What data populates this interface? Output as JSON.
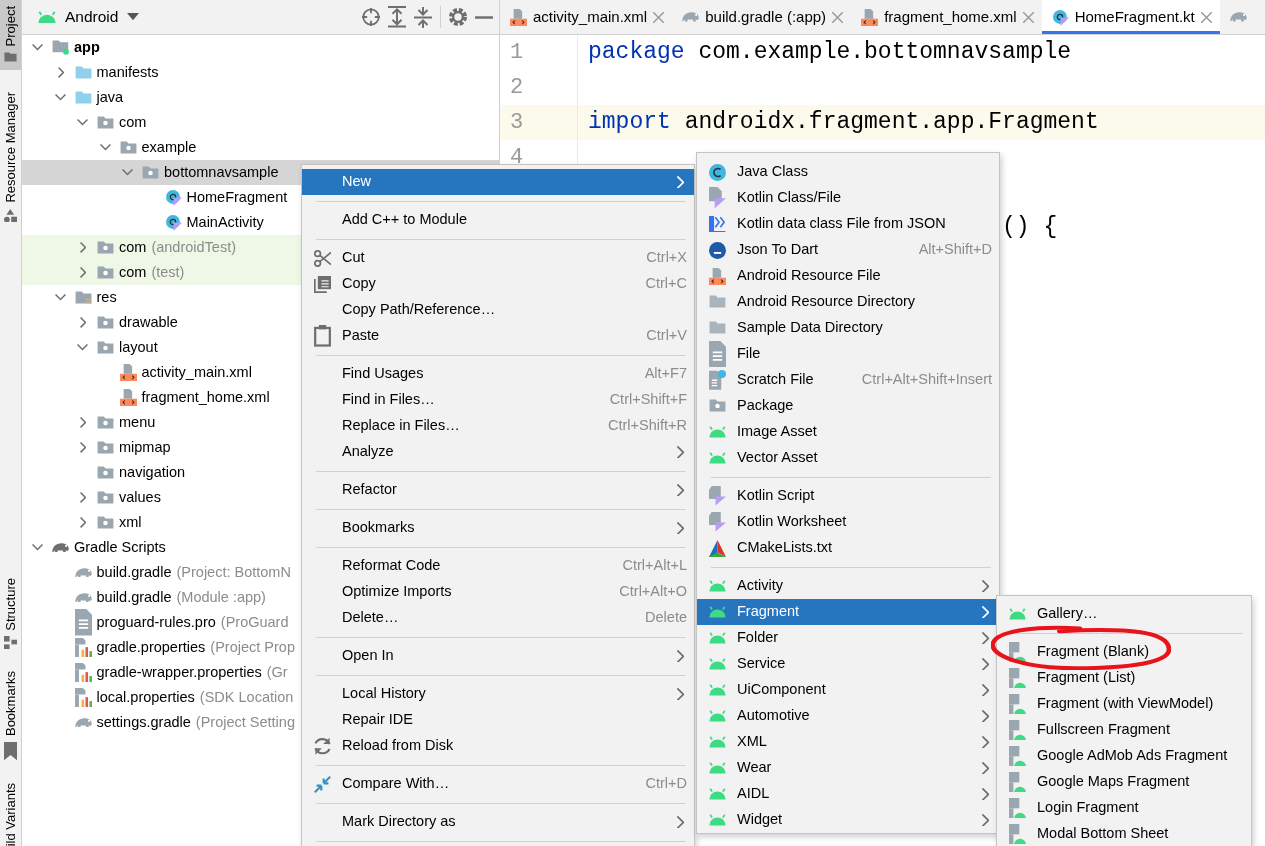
{
  "tool_strip": [
    {
      "label": "Project",
      "selected": true,
      "kind": "folder"
    },
    {
      "label": "Resource Manager",
      "selected": false,
      "kind": "shapes"
    },
    {
      "label": "Structure",
      "selected": false,
      "kind": "structure"
    },
    {
      "label": "Bookmarks",
      "selected": false,
      "kind": "bookmark"
    },
    {
      "label": "ild Variants",
      "selected": false
    }
  ],
  "project_panel": {
    "view": "Android",
    "tree": [
      {
        "label": "app",
        "kind": "module",
        "expanded": true,
        "selected": false,
        "test": false,
        "children": [
          {
            "label": "manifests",
            "kind": "folder",
            "expanded": false,
            "selected": false,
            "test": false
          },
          {
            "label": "java",
            "kind": "folder",
            "expanded": true,
            "selected": false,
            "test": false,
            "children": [
              {
                "label": "com",
                "kind": "package",
                "expanded": true,
                "selected": false,
                "test": false,
                "children": [
                  {
                    "label": "example",
                    "kind": "package",
                    "expanded": true,
                    "selected": false,
                    "test": false,
                    "children": [
                      {
                        "label": "bottomnavsample",
                        "kind": "package",
                        "expanded": true,
                        "selected": true,
                        "test": false,
                        "children": [
                          {
                            "label": "HomeFragment",
                            "kind": "kotlin",
                            "selected": false,
                            "test": false
                          },
                          {
                            "label": "MainActivity",
                            "kind": "kotlin",
                            "selected": false,
                            "test": false
                          }
                        ]
                      }
                    ]
                  }
                ]
              },
              {
                "label": "com",
                "detail": "(androidTest)",
                "kind": "package",
                "expanded": false,
                "selected": false,
                "test": true
              },
              {
                "label": "com",
                "detail": "(test)",
                "kind": "package",
                "expanded": false,
                "selected": false,
                "test": true
              }
            ]
          },
          {
            "label": "res",
            "kind": "res",
            "expanded": true,
            "selected": false,
            "test": false,
            "children": [
              {
                "label": "drawable",
                "kind": "package",
                "expanded": false,
                "selected": false,
                "test": false
              },
              {
                "label": "layout",
                "kind": "package",
                "expanded": true,
                "selected": false,
                "test": false,
                "children": [
                  {
                    "label": "activity_main.xml",
                    "kind": "xml",
                    "selected": false,
                    "test": false
                  },
                  {
                    "label": "fragment_home.xml",
                    "kind": "xml",
                    "selected": false,
                    "test": false
                  }
                ]
              },
              {
                "label": "menu",
                "kind": "package",
                "expanded": false,
                "selected": false,
                "test": false
              },
              {
                "label": "mipmap",
                "kind": "package",
                "expanded": false,
                "selected": false,
                "test": false
              },
              {
                "label": "navigation",
                "kind": "package",
                "selected": false,
                "test": false
              },
              {
                "label": "values",
                "kind": "package",
                "expanded": false,
                "selected": false,
                "test": false
              },
              {
                "label": "xml",
                "kind": "package",
                "expanded": false,
                "selected": false,
                "test": false
              }
            ]
          }
        ]
      },
      {
        "label": "Gradle Scripts",
        "kind": "gradle-root",
        "expanded": true,
        "selected": false,
        "test": false,
        "children": [
          {
            "label": "build.gradle",
            "detail": "(Project: BottomN",
            "kind": "gradle",
            "selected": false,
            "test": false
          },
          {
            "label": "build.gradle",
            "detail": "(Module :app)",
            "kind": "gradle",
            "selected": false,
            "test": false
          },
          {
            "label": "proguard-rules.pro",
            "detail": "(ProGuard",
            "kind": "text",
            "selected": false,
            "test": false
          },
          {
            "label": "gradle.properties",
            "detail": "(Project Prop",
            "kind": "properties",
            "selected": false,
            "test": false
          },
          {
            "label": "gradle-wrapper.properties",
            "detail": "(Gr",
            "kind": "properties",
            "selected": false,
            "test": false
          },
          {
            "label": "local.properties",
            "detail": "(SDK Location",
            "kind": "properties",
            "selected": false,
            "test": false
          },
          {
            "label": "settings.gradle",
            "detail": "(Project Setting",
            "kind": "gradle",
            "selected": false,
            "test": false
          }
        ]
      }
    ]
  },
  "editor_tabs": [
    {
      "label": "activity_main.xml",
      "kind": "xml",
      "selected": false
    },
    {
      "label": "build.gradle (:app)",
      "kind": "gradle",
      "selected": false
    },
    {
      "label": "fragment_home.xml",
      "kind": "xml",
      "selected": false
    },
    {
      "label": "HomeFragment.kt",
      "kind": "kotlin",
      "selected": true
    },
    {
      "kind": "gradle",
      "selected": false
    }
  ],
  "code_lines": [
    {
      "number": "1",
      "current": false,
      "tokens": [
        {
          "text": "package",
          "kind": "keyword"
        },
        {
          "text": " com.example.bottomnavsample",
          "kind": "plain"
        }
      ]
    },
    {
      "number": "2",
      "current": false
    },
    {
      "number": "3",
      "current": true,
      "tokens": [
        {
          "text": "import",
          "kind": "keyword"
        },
        {
          "text": " androidx.fragment.app.Fragment",
          "kind": "plain"
        }
      ]
    },
    {
      "number": "4",
      "current": false
    },
    {
      "tokens": [
        {
          "text": "() {",
          "kind": "tail"
        }
      ]
    }
  ],
  "context_menu": {
    "items": [
      {
        "kind": "plain",
        "label": "New",
        "selected": true,
        "submenu": true
      },
      {
        "kind": "separator"
      },
      {
        "kind": "plain",
        "label": "Add C++ to Module",
        "selected": false,
        "submenu": false
      },
      {
        "kind": "separator"
      },
      {
        "kind": "cut",
        "label": "Cut",
        "shortcut": "Ctrl+X",
        "selected": false,
        "submenu": false
      },
      {
        "kind": "copy",
        "label": "Copy",
        "shortcut": "Ctrl+C",
        "selected": false,
        "submenu": false
      },
      {
        "kind": "plain",
        "label": "Copy Path/Reference…",
        "selected": false,
        "submenu": false
      },
      {
        "kind": "paste",
        "label": "Paste",
        "shortcut": "Ctrl+V",
        "selected": false,
        "submenu": false
      },
      {
        "kind": "separator"
      },
      {
        "kind": "plain",
        "label": "Find Usages",
        "shortcut": "Alt+F7",
        "selected": false,
        "submenu": false
      },
      {
        "kind": "plain",
        "label": "Find in Files…",
        "shortcut": "Ctrl+Shift+F",
        "selected": false,
        "submenu": false
      },
      {
        "kind": "plain",
        "label": "Replace in Files…",
        "shortcut": "Ctrl+Shift+R",
        "selected": false,
        "submenu": false
      },
      {
        "kind": "plain",
        "label": "Analyze",
        "selected": false,
        "submenu": true
      },
      {
        "kind": "separator"
      },
      {
        "kind": "plain",
        "label": "Refactor",
        "selected": false,
        "submenu": true
      },
      {
        "kind": "separator"
      },
      {
        "kind": "plain",
        "label": "Bookmarks",
        "selected": false,
        "submenu": true
      },
      {
        "kind": "separator"
      },
      {
        "kind": "plain",
        "label": "Reformat Code",
        "shortcut": "Ctrl+Alt+L",
        "selected": false,
        "submenu": false
      },
      {
        "kind": "plain",
        "label": "Optimize Imports",
        "shortcut": "Ctrl+Alt+O",
        "selected": false,
        "submenu": false
      },
      {
        "kind": "plain",
        "label": "Delete…",
        "shortcut": "Delete",
        "selected": false,
        "submenu": false
      },
      {
        "kind": "separator"
      },
      {
        "kind": "plain",
        "label": "Open In",
        "selected": false,
        "submenu": true
      },
      {
        "kind": "separator"
      },
      {
        "kind": "plain",
        "label": "Local History",
        "selected": false,
        "submenu": true
      },
      {
        "kind": "plain",
        "label": "Repair IDE",
        "selected": false,
        "submenu": false
      },
      {
        "kind": "reload",
        "label": "Reload from Disk",
        "selected": false,
        "submenu": false
      },
      {
        "kind": "separator"
      },
      {
        "kind": "compare",
        "label": "Compare With…",
        "shortcut": "Ctrl+D",
        "selected": false,
        "submenu": false
      },
      {
        "kind": "separator"
      },
      {
        "kind": "plain",
        "label": "Mark Directory as",
        "selected": false,
        "submenu": true
      },
      {
        "kind": "separator"
      }
    ]
  },
  "new_submenu": {
    "items": [
      {
        "kind": "java",
        "label": "Java Class",
        "selected": false,
        "submenu": false
      },
      {
        "kind": "kotlin-file",
        "label": "Kotlin Class/File",
        "selected": false,
        "submenu": false
      },
      {
        "kind": "json-kt",
        "label": "Kotlin data class File from JSON",
        "selected": false,
        "submenu": false
      },
      {
        "kind": "json-dart",
        "label": "Json To Dart",
        "shortcut": "Alt+Shift+D",
        "selected": false,
        "submenu": false
      },
      {
        "kind": "xml",
        "label": "Android Resource File",
        "selected": false,
        "submenu": false
      },
      {
        "kind": "plain-folder",
        "label": "Android Resource Directory",
        "selected": false,
        "submenu": false
      },
      {
        "kind": "plain-folder",
        "label": "Sample Data Directory",
        "selected": false,
        "submenu": false
      },
      {
        "kind": "text",
        "label": "File",
        "selected": false,
        "submenu": false
      },
      {
        "kind": "scratch",
        "label": "Scratch File",
        "shortcut": "Ctrl+Alt+Shift+Insert",
        "selected": false,
        "submenu": false
      },
      {
        "kind": "package",
        "label": "Package",
        "selected": false,
        "submenu": false
      },
      {
        "kind": "android",
        "label": "Image Asset",
        "selected": false,
        "submenu": false
      },
      {
        "kind": "android",
        "label": "Vector Asset",
        "selected": false,
        "submenu": false
      },
      {
        "kind": "separator"
      },
      {
        "kind": "kotlin-script",
        "label": "Kotlin Script",
        "selected": false,
        "submenu": false
      },
      {
        "kind": "kotlin-script",
        "label": "Kotlin Worksheet",
        "selected": false,
        "submenu": false
      },
      {
        "kind": "cmake",
        "label": "CMakeLists.txt",
        "selected": false,
        "submenu": false
      },
      {
        "kind": "separator"
      },
      {
        "kind": "android",
        "label": "Activity",
        "selected": false,
        "submenu": true
      },
      {
        "kind": "android",
        "label": "Fragment",
        "selected": true,
        "submenu": true
      },
      {
        "kind": "android",
        "label": "Folder",
        "selected": false,
        "submenu": true
      },
      {
        "kind": "android",
        "label": "Service",
        "selected": false,
        "submenu": true
      },
      {
        "kind": "android",
        "label": "UiComponent",
        "selected": false,
        "submenu": true
      },
      {
        "kind": "android",
        "label": "Automotive",
        "selected": false,
        "submenu": true
      },
      {
        "kind": "android",
        "label": "XML",
        "selected": false,
        "submenu": true
      },
      {
        "kind": "android",
        "label": "Wear",
        "selected": false,
        "submenu": true
      },
      {
        "kind": "android",
        "label": "AIDL",
        "selected": false,
        "submenu": true
      },
      {
        "kind": "android",
        "label": "Widget",
        "selected": false,
        "submenu": true
      }
    ]
  },
  "fragment_submenu": {
    "items": [
      {
        "kind": "android",
        "label": "Gallery…",
        "selected": false,
        "circled": false
      },
      {
        "kind": "separator"
      },
      {
        "kind": "template",
        "label": "Fragment (Blank)",
        "selected": false,
        "circled": true
      },
      {
        "kind": "template",
        "label": "Fragment (List)",
        "selected": false,
        "circled": false
      },
      {
        "kind": "template",
        "label": "Fragment (with ViewModel)",
        "selected": false,
        "circled": false
      },
      {
        "kind": "template",
        "label": "Fullscreen Fragment",
        "selected": false,
        "circled": false
      },
      {
        "kind": "template",
        "label": "Google AdMob Ads Fragment",
        "selected": false,
        "circled": false
      },
      {
        "kind": "template",
        "label": "Google Maps Fragment",
        "selected": false,
        "circled": false
      },
      {
        "kind": "template",
        "label": "Login Fragment",
        "selected": false,
        "circled": false
      },
      {
        "kind": "template",
        "label": "Modal Bottom Sheet",
        "selected": false,
        "circled": false
      }
    ]
  }
}
